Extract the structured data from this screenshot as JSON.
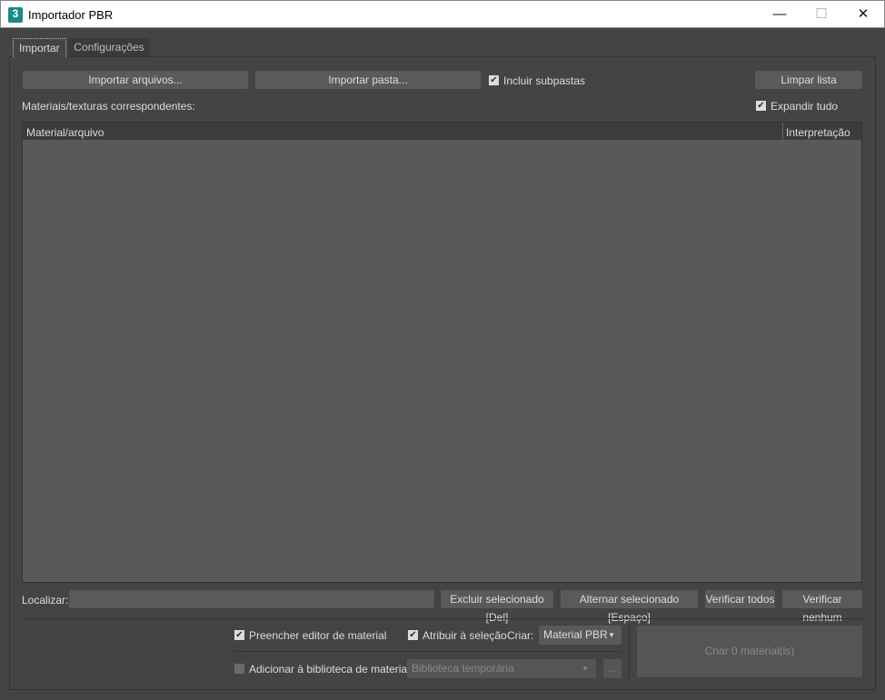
{
  "window": {
    "title": "Importador PBR",
    "icon_label": "3",
    "minimize": "—",
    "maximize": "☐",
    "close": "✕"
  },
  "tabs": [
    {
      "label": "Importar"
    },
    {
      "label": "Configurações"
    }
  ],
  "toolbar": {
    "import_files": "Importar arquivos...",
    "import_folder": "Importar pasta...",
    "include_subfolders": "Incluir subpastas",
    "include_subfolders_checked": true,
    "clear_list": "Limpar lista"
  },
  "list": {
    "label": "Materiais/texturas correspondentes:",
    "expand_all": "Expandir tudo",
    "expand_all_checked": true,
    "columns": [
      "Material/arquivo",
      "Interpretação"
    ],
    "rows": []
  },
  "find": {
    "label": "Localizar:",
    "value": ""
  },
  "actions": {
    "delete_selected": "Excluir selecionado [Del]",
    "toggle_selected": "Alternar selecionado [Espaço]",
    "check_all": "Verificar todos",
    "check_none": "Verificar nenhum"
  },
  "options": {
    "fill_editor": "Preencher editor de material",
    "fill_editor_checked": true,
    "assign_selection": "Atribuir à seleção",
    "assign_selection_checked": true,
    "create_label": "Criar:",
    "create_value": "Material PBR",
    "add_library": "Adicionar à biblioteca de materiais",
    "add_library_checked": false,
    "library_value": "Biblioteca temporária",
    "browse": "...",
    "create_button": "Criar 0 material(is)"
  }
}
